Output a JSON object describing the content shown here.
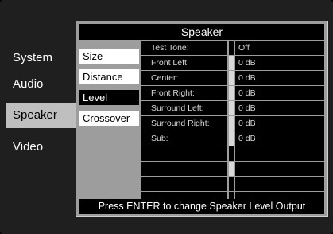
{
  "left_menu": {
    "items": [
      {
        "label": "System"
      },
      {
        "label": "Audio"
      },
      {
        "label": "Speaker"
      },
      {
        "label": "Video"
      }
    ],
    "active_index": 2
  },
  "panel": {
    "title": "Speaker",
    "submenu": [
      {
        "label": "Size"
      },
      {
        "label": "Distance"
      },
      {
        "label": "Level"
      },
      {
        "label": "Crossover"
      }
    ],
    "active_submenu_index": 2,
    "settings": [
      {
        "label": "Test Tone:",
        "value": "Off",
        "marker": false
      },
      {
        "label": "Front Left:",
        "value": "0 dB",
        "marker": true
      },
      {
        "label": "Center:",
        "value": "0 dB",
        "marker": true
      },
      {
        "label": "Front Right:",
        "value": "0 dB",
        "marker": true
      },
      {
        "label": "Surround Left:",
        "value": "0 dB",
        "marker": true
      },
      {
        "label": "Surround Right:",
        "value": "0 dB",
        "marker": true
      },
      {
        "label": "Sub:",
        "value": "0 dB",
        "marker": true
      },
      {
        "label": "",
        "value": "",
        "marker": false
      },
      {
        "label": "",
        "value": "",
        "marker": true
      },
      {
        "label": "",
        "value": "",
        "marker": false
      },
      {
        "label": "",
        "value": "",
        "marker": false
      }
    ],
    "footer": "Press ENTER to change Speaker Level Output"
  },
  "colors": {
    "background": "#1f1f1f",
    "panel": "#9d9d9d",
    "active_menu": "#bfbfbf",
    "cell": "#000000"
  }
}
